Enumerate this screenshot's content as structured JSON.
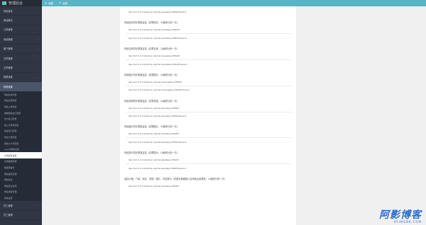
{
  "sidebar": {
    "brand": "管理后台",
    "items_top": [
      {
        "label": "系统首页"
      },
      {
        "label": "网站概况"
      },
      {
        "label": "订单管理"
      },
      {
        "label": "商品管理"
      },
      {
        "label": "客户管理"
      },
      {
        "label": "文章管理"
      },
      {
        "label": "文章管理"
      },
      {
        "label": "权限设置"
      }
    ],
    "active_parent": "系统设置",
    "sub_items": [
      {
        "label": "网站信息配置"
      },
      {
        "label": "网站资源配置"
      },
      {
        "label": "网站上传配置"
      },
      {
        "label": "邮箱短信接口配置"
      },
      {
        "label": "支付接口配置"
      },
      {
        "label": "第三方登录配置"
      },
      {
        "label": "快递接口配置"
      },
      {
        "label": "地址分析配置"
      },
      {
        "label": "微信公众号配置"
      },
      {
        "label": "Logo与图标设置"
      },
      {
        "label": "计划任务设置",
        "active": true
      },
      {
        "label": "系统数据管理"
      },
      {
        "label": "数据库备份"
      },
      {
        "label": "网站缓存清理"
      },
      {
        "label": "网站优化"
      },
      {
        "label": "网站安全检测"
      },
      {
        "label": "域名授权管理"
      },
      {
        "label": "其他设置"
      }
    ],
    "items_bottom": [
      {
        "label": "员工管理"
      },
      {
        "label": "员工管理"
      }
    ]
  },
  "topbar": {
    "refresh_label": "刷新",
    "back_label": "返回"
  },
  "blocks": [
    {
      "title": "",
      "urls": [
        "http://127.0.0.1:4124/cron.php?do=price&key=555267&exit=1"
      ]
    },
    {
      "title": "商品库存同步更新监控（仅限库存，10级别分钟一次）",
      "urls": [
        "http://127.0.0.1:4124/cron.php?do=stock&key=555267",
        "http://127.0.0.1:4124/cron.php?do=stock&key=555267&exit=1"
      ]
    },
    {
      "title": "商品名称同步更新监控（仅限名称，10级别分钟一次）",
      "urls": [
        "http://127.0.0.1:4124/cron.php?do=name&key=555267",
        "http://127.0.0.1:4124/cron.php?do=name&key=555267&exit=1"
      ]
    },
    {
      "title": "商品图片同步更新监控（仅限图片，10级别分钟一次）",
      "urls": [
        "http://127.0.0.1:4124/cron.php?do=shoping&key=555267",
        "http://127.0.0.1:4124/cron.php?do=shoping&key=555267&exit=1"
      ]
    },
    {
      "title": "商品说明同步更新监控（仅限说明，10级别分钟一次）",
      "urls": [
        "http://127.0.0.1:4124/cron.php?do=desc&key=555267",
        "http://127.0.0.1:4124/cron.php?do=desc&key=555267&exit=1"
      ]
    },
    {
      "title": "商品图片同步更新监控（仅限图片，10级别分钟一次）",
      "urls": [
        "http://127.0.0.1:4124/cron.php?do=desc&key=555267",
        "http://127.0.0.1:4124/cron.php?do=desc&key=555267&exit=1"
      ]
    },
    {
      "title": "商品提示同步更新监控（仅限提示，10级别分钟一次）",
      "urls": [
        "http://127.0.0.1:4124/cron.php?do=alert&key=555267",
        "http://127.0.0.1:4124/cron.php?do=alert&key=555267&exit=1"
      ]
    },
    {
      "title": "监控价格、介绍、库存、说明、图片、内容提示（仅限对接模组以及商品全量更新，10级别分钟一次）",
      "urls": [
        "http://127.0.0.1:4124/cron.php?do=price&key=555267"
      ]
    }
  ],
  "watermark": {
    "main": "阿影博客",
    "sub": "AYINGBK.COM"
  },
  "colors": {
    "sidebar_bg": "#2f3644",
    "topbar_bg": "#5bb3c6",
    "watermark": "#2b6fd0"
  }
}
